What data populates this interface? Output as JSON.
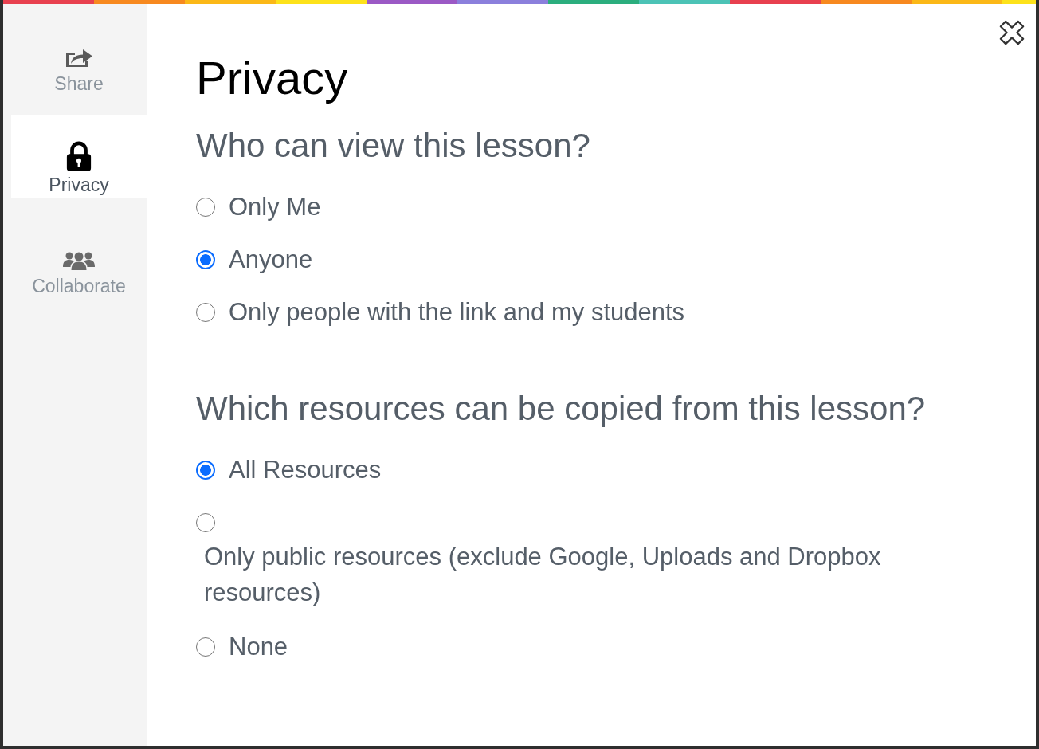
{
  "sidebar": {
    "items": [
      {
        "label": "Share",
        "selected": false
      },
      {
        "label": "Privacy",
        "selected": true
      },
      {
        "label": "Collaborate",
        "selected": false
      }
    ]
  },
  "title": "Privacy",
  "sections": [
    {
      "heading": "Who can view this lesson?",
      "options": [
        {
          "kind": "inline",
          "label": "Only Me",
          "selected": false
        },
        {
          "kind": "inline",
          "label": "Anyone",
          "selected": true
        },
        {
          "kind": "inline",
          "label": "Only people with the link and my students",
          "selected": false
        }
      ]
    },
    {
      "heading": "Which resources can be copied from this lesson?",
      "options": [
        {
          "kind": "inline",
          "label": "All Resources",
          "selected": true
        },
        {
          "kind": "stacked",
          "label": "Only public resources (exclude Google, Uploads and Dropbox resources)",
          "selected": false
        },
        {
          "kind": "inline",
          "label": "None",
          "selected": false
        }
      ]
    }
  ]
}
